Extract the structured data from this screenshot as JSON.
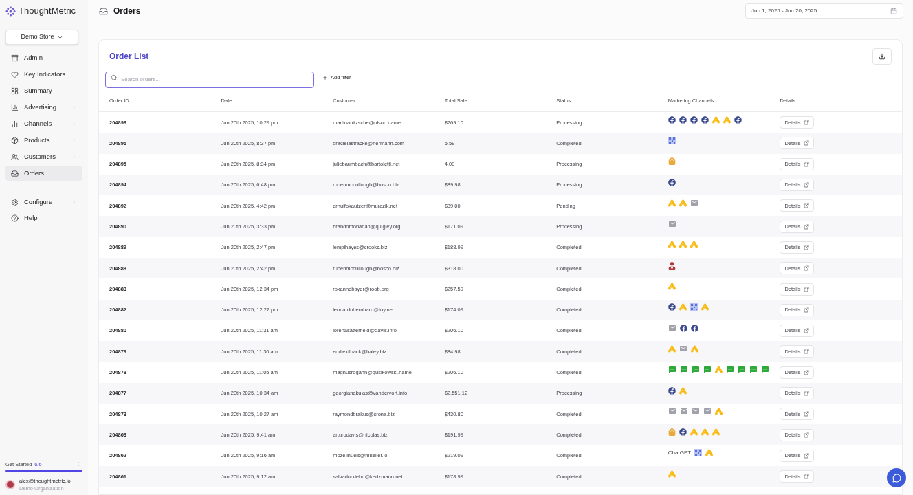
{
  "brand": {
    "name": "ThoughtMetric"
  },
  "store_selector": {
    "label": "Demo Store"
  },
  "nav": [
    {
      "label": "Admin",
      "kind": "admin",
      "expandable": false,
      "selected": false
    },
    {
      "label": "Key Indicators",
      "kind": "heart",
      "expandable": false,
      "selected": false
    },
    {
      "label": "Summary",
      "kind": "grid",
      "expandable": false,
      "selected": false
    },
    {
      "label": "Advertising",
      "kind": "chart",
      "expandable": true,
      "selected": false
    },
    {
      "label": "Channels",
      "kind": "bars",
      "expandable": true,
      "selected": false
    },
    {
      "label": "Products",
      "kind": "box",
      "expandable": true,
      "selected": false
    },
    {
      "label": "Customers",
      "kind": "users",
      "expandable": true,
      "selected": false
    },
    {
      "label": "Orders",
      "kind": "inbox",
      "expandable": false,
      "selected": true
    }
  ],
  "nav_bottom": [
    {
      "label": "Configure",
      "kind": "gear",
      "expandable": true,
      "selected": false
    },
    {
      "label": "Help",
      "kind": "help",
      "expandable": false,
      "selected": false
    }
  ],
  "get_started": {
    "label": "Get Started",
    "count": "6/6",
    "level": 1
  },
  "user": {
    "email": "alex@thoughtmetric.io",
    "org": "Demo Organization"
  },
  "header": {
    "title": "Orders",
    "date_range": "Jun 1, 2025 - Jun 20, 2025"
  },
  "order_list": {
    "title": "Order List",
    "search_placeholder": "Search orders...",
    "add_filter": "Add filter",
    "columns": [
      "Order ID",
      "Date",
      "Customer",
      "Total Sale",
      "Status",
      "Marketing Channels",
      "Details"
    ],
    "rows": [
      {
        "id": "204898",
        "date": "Jun 20th 2025, 10:29 pm",
        "customer": "martinanitzsche@olson.name",
        "total": "$269.10",
        "status": "Processing",
        "channels": [
          {
            "kind": "facebook"
          },
          {
            "kind": "facebook"
          },
          {
            "kind": "facebook"
          },
          {
            "kind": "facebook"
          },
          {
            "kind": "google"
          },
          {
            "kind": "google"
          },
          {
            "kind": "facebook"
          }
        ],
        "details": "Details"
      },
      {
        "id": "204896",
        "date": "Jun 20th 2025, 8:37 pm",
        "customer": "gracielastracke@hermann.com",
        "total": "5.59",
        "status": "Completed",
        "channels": [
          {
            "kind": "qr"
          }
        ],
        "details": "Details"
      },
      {
        "id": "204895",
        "date": "Jun 20th 2025, 8:34 pm",
        "customer": "juliebaumbach@bartoletti.net",
        "total": "4.09",
        "status": "Processing",
        "channels": [
          {
            "kind": "shop"
          }
        ],
        "details": "Details"
      },
      {
        "id": "204894",
        "date": "Jun 20th 2025, 6:48 pm",
        "customer": "rubenmccullough@bosco.biz",
        "total": "$89.98",
        "status": "Processing",
        "channels": [
          {
            "kind": "facebook"
          }
        ],
        "details": "Details"
      },
      {
        "id": "204892",
        "date": "Jun 20th 2025, 4:42 pm",
        "customer": "arnulfokautzer@murazik.net",
        "total": "$89.00",
        "status": "Pending",
        "channels": [
          {
            "kind": "google"
          },
          {
            "kind": "google"
          },
          {
            "kind": "email"
          }
        ],
        "details": "Details"
      },
      {
        "id": "204890",
        "date": "Jun 20th 2025, 3:33 pm",
        "customer": "brandomonahan@quigley.org",
        "total": "$171.09",
        "status": "Processing",
        "channels": [
          {
            "kind": "email"
          }
        ],
        "details": "Details"
      },
      {
        "id": "204889",
        "date": "Jun 20th 2025, 2:47 pm",
        "customer": "lempihayes@crooks.biz",
        "total": "$188.99",
        "status": "Completed",
        "channels": [
          {
            "kind": "google"
          },
          {
            "kind": "google"
          },
          {
            "kind": "google"
          }
        ],
        "details": "Details"
      },
      {
        "id": "204888",
        "date": "Jun 20th 2025, 2:42 pm",
        "customer": "rubenmccullough@bosco.biz",
        "total": "$318.00",
        "status": "Completed",
        "channels": [
          {
            "kind": "person"
          }
        ],
        "details": "Details"
      },
      {
        "id": "204883",
        "date": "Jun 20th 2025, 12:34 pm",
        "customer": "roxannebayer@roob.org",
        "total": "$257.59",
        "status": "Completed",
        "channels": [
          {
            "kind": "google"
          }
        ],
        "details": "Details"
      },
      {
        "id": "204882",
        "date": "Jun 20th 2025, 12:27 pm",
        "customer": "leonardobernhard@toy.net",
        "total": "$174.09",
        "status": "Completed",
        "channels": [
          {
            "kind": "facebook"
          },
          {
            "kind": "google"
          },
          {
            "kind": "qr"
          },
          {
            "kind": "google"
          }
        ],
        "details": "Details"
      },
      {
        "id": "204880",
        "date": "Jun 20th 2025, 11:31 am",
        "customer": "lorenasatterfield@davis.info",
        "total": "$206.10",
        "status": "Completed",
        "channels": [
          {
            "kind": "email"
          },
          {
            "kind": "facebook"
          },
          {
            "kind": "facebook"
          }
        ],
        "details": "Details"
      },
      {
        "id": "204879",
        "date": "Jun 20th 2025, 11:30 am",
        "customer": "eddiekilback@haley.biz",
        "total": "$84.98",
        "status": "Completed",
        "channels": [
          {
            "kind": "google"
          },
          {
            "kind": "email"
          },
          {
            "kind": "google"
          }
        ],
        "details": "Details"
      },
      {
        "id": "204878",
        "date": "Jun 20th 2025, 11:05 am",
        "customer": "magnusrogahn@gusikowski.name",
        "total": "$206.10",
        "status": "Completed",
        "channels": [
          {
            "kind": "sms"
          },
          {
            "kind": "sms"
          },
          {
            "kind": "sms"
          },
          {
            "kind": "sms"
          },
          {
            "kind": "google"
          },
          {
            "kind": "sms"
          },
          {
            "kind": "sms"
          },
          {
            "kind": "sms"
          },
          {
            "kind": "sms"
          }
        ],
        "details": "Details"
      },
      {
        "id": "204877",
        "date": "Jun 20th 2025, 10:34 am",
        "customer": "georgianakulas@vandervort.info",
        "total": "$2,551.12",
        "status": "Processing",
        "channels": [
          {
            "kind": "facebook"
          },
          {
            "kind": "google"
          }
        ],
        "details": "Details"
      },
      {
        "id": "204873",
        "date": "Jun 20th 2025, 10:27 am",
        "customer": "raymondbrakus@crona.biz",
        "total": "$430.80",
        "status": "Completed",
        "channels": [
          {
            "kind": "email"
          },
          {
            "kind": "email"
          },
          {
            "kind": "email"
          },
          {
            "kind": "email"
          },
          {
            "kind": "google"
          }
        ],
        "details": "Details"
      },
      {
        "id": "204863",
        "date": "Jun 20th 2025, 9:41 am",
        "customer": "arturodavis@nicolas.biz",
        "total": "$191.99",
        "status": "Completed",
        "channels": [
          {
            "kind": "shop"
          },
          {
            "kind": "facebook"
          },
          {
            "kind": "google"
          },
          {
            "kind": "google"
          },
          {
            "kind": "google"
          }
        ],
        "details": "Details"
      },
      {
        "id": "204862",
        "date": "Jun 20th 2025, 9:16 am",
        "customer": "mozellhuels@mueller.io",
        "total": "$219.09",
        "status": "Completed",
        "channels": [
          {
            "kind": "text",
            "label": "ChatGPT"
          },
          {
            "kind": "qr"
          },
          {
            "kind": "google"
          }
        ],
        "details": "Details"
      },
      {
        "id": "204861",
        "date": "Jun 20th 2025, 9:12 am",
        "customer": "salvadorkiehn@kertzmann.net",
        "total": "$178.99",
        "status": "Completed",
        "channels": [
          {
            "kind": "google"
          }
        ],
        "details": "Details"
      }
    ]
  }
}
